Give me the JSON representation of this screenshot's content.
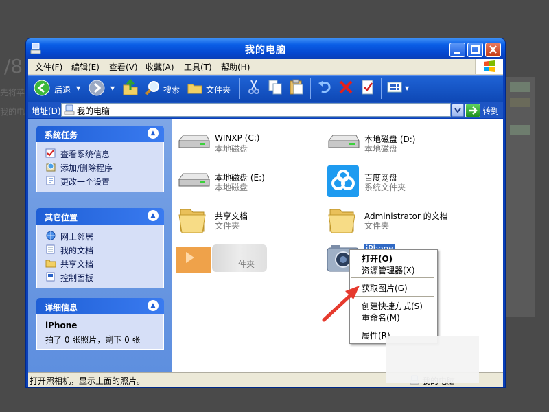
{
  "window": {
    "title": "我的电脑"
  },
  "menubar": [
    "文件(F)",
    "编辑(E)",
    "查看(V)",
    "收藏(A)",
    "工具(T)",
    "帮助(H)"
  ],
  "toolbar": {
    "back": "后退",
    "search": "搜索",
    "folders": "文件夹"
  },
  "address": {
    "label": "地址(D)",
    "value": "我的电脑",
    "go": "转到"
  },
  "panels": [
    {
      "title": "系统任务",
      "items": [
        "查看系统信息",
        "添加/删除程序",
        "更改一个设置"
      ]
    },
    {
      "title": "其它位置",
      "items": [
        "网上邻居",
        "我的文档",
        "共享文档",
        "控制面板"
      ]
    },
    {
      "title": "详细信息",
      "name": "iPhone",
      "detail": "拍了 0 张照片，剩下 0 张"
    }
  ],
  "files": [
    {
      "name": "WINXP (C:)",
      "type": "本地磁盘",
      "icon": "drive-icon"
    },
    {
      "name": "本地磁盘 (D:)",
      "type": "本地磁盘",
      "icon": "drive-icon"
    },
    {
      "name": "本地磁盘 (E:)",
      "type": "本地磁盘",
      "icon": "drive-icon"
    },
    {
      "name": "百度网盘",
      "type": "系统文件夹",
      "icon": "baidu-netdisk-icon"
    },
    {
      "name": "共享文档",
      "type": "文件夹",
      "icon": "folder-icon"
    },
    {
      "name": "Administrator 的文档",
      "type": "文件夹",
      "icon": "folder-icon"
    },
    {
      "name": "",
      "type": "件夹",
      "icon": "folder-icon"
    },
    {
      "name": "iPhone",
      "type": "",
      "icon": "camera-icon"
    }
  ],
  "context_menu": [
    "打开(O)",
    "资源管理器(X)",
    "获取图片(G)",
    "创建快捷方式(S)",
    "重命名(M)",
    "属性(R)"
  ],
  "status": {
    "text": "打开照相机，显示上面的照片。",
    "right": "我的电脑"
  },
  "background": {
    "text1": "先将苹",
    "text2": "我的电",
    "text3": "/8"
  },
  "colors": {
    "accent": "#0a3fb7",
    "annotation_arrow": "#e63a2e"
  }
}
